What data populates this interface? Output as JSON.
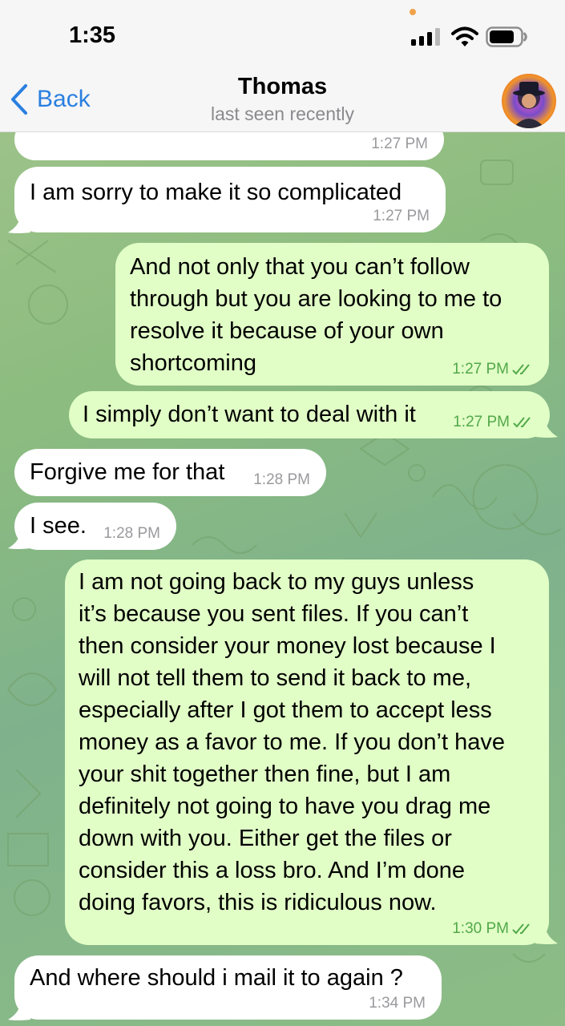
{
  "status_bar": {
    "time": "1:35",
    "icons": [
      "signal-icon",
      "wifi-icon",
      "battery-icon"
    ]
  },
  "header": {
    "back_label": "Back",
    "contact_name": "Thomas",
    "contact_status": "last seen recently",
    "accent_color": "#2b7fe0"
  },
  "messages": [
    {
      "direction": "incoming",
      "text": "",
      "time": "1:27 PM"
    },
    {
      "direction": "incoming",
      "text": "I am sorry to make it so complicated",
      "time": "1:27 PM"
    },
    {
      "direction": "outgoing",
      "text": "And not only that you can’t follow\nthrough but you are looking to me to\nresolve it because of your own\nshortcoming",
      "time": "1:27 PM",
      "read": true
    },
    {
      "direction": "outgoing",
      "text": "I simply don’t want to deal with it",
      "time": "1:27 PM",
      "read": true
    },
    {
      "direction": "incoming",
      "text": "Forgive me for that",
      "time": "1:28 PM"
    },
    {
      "direction": "incoming",
      "text": "I see.",
      "time": "1:28 PM"
    },
    {
      "direction": "outgoing",
      "text": "I am not going back to my guys unless\nit’s because you sent files. If you can’t\nthen consider your money lost because I\nwill not tell them to send it back to me,\nespecially after I got them to accept less\nmoney as a favor to me. If you don’t have\nyour shit together then fine, but I am\ndefinitely not going to have you drag me\ndown with you. Either get the files or\nconsider this a loss bro. And I’m done\ndoing favors, this is ridiculous now.",
      "time": "1:30 PM",
      "read": true
    },
    {
      "direction": "incoming",
      "text": "And where should i mail it to again ?",
      "time": "1:34 PM"
    }
  ],
  "colors": {
    "incoming_bubble": "#ffffff",
    "outgoing_bubble": "#e1fec6",
    "outgoing_meta": "#52a84a",
    "header_bg": "#f6f6f6"
  }
}
